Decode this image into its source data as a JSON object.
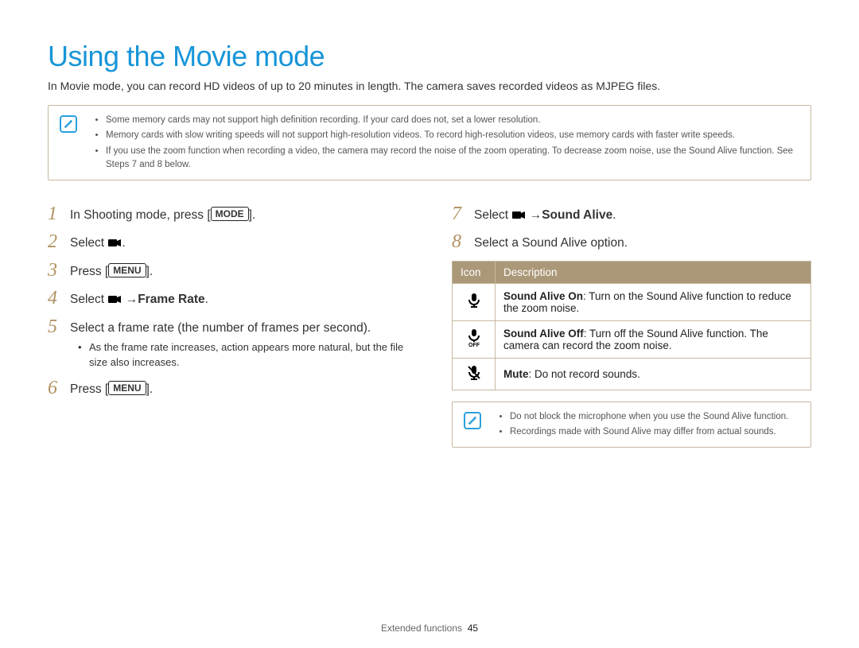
{
  "title": "Using the Movie mode",
  "intro": "In Movie mode, you can record HD videos of up to 20 minutes in length. The camera saves recorded videos as MJPEG files.",
  "note1": {
    "items": [
      "Some memory cards may not support high definition recording. If your card does not, set a lower resolution.",
      "Memory cards with slow writing speeds will not support high-resolution videos. To record high-resolution videos, use memory cards with faster write speeds.",
      "If you use the zoom function when recording a video, the camera may record the noise of the zoom operating. To decrease zoom noise, use the Sound Alive function. See Steps 7 and 8 below."
    ]
  },
  "badges": {
    "mode": "MODE",
    "menu": "MENU"
  },
  "steps_left": {
    "s1": {
      "num": "1",
      "pre": "In Shooting mode, press [",
      "post": "]."
    },
    "s2": {
      "num": "2",
      "pre": "Select ",
      "post": "."
    },
    "s3": {
      "num": "3",
      "pre": "Press [",
      "post": "]."
    },
    "s4": {
      "num": "4",
      "pre": "Select ",
      "link": "Frame Rate",
      "post": "."
    },
    "s5": {
      "num": "5",
      "text": "Select a frame rate (the number of frames per second).",
      "sub": "As the frame rate increases, action appears more natural, but the file size also increases."
    },
    "s6": {
      "num": "6",
      "pre": "Press [",
      "post": "]."
    }
  },
  "steps_right": {
    "s7": {
      "num": "7",
      "pre": "Select ",
      "link": "Sound Alive",
      "post": "."
    },
    "s8": {
      "num": "8",
      "text": "Select a Sound Alive option."
    }
  },
  "table": {
    "h1": "Icon",
    "h2": "Description",
    "rows": [
      {
        "title": "Sound Alive On",
        "desc": ": Turn on the Sound Alive function to reduce the zoom noise."
      },
      {
        "title": "Sound Alive Off",
        "desc": ": Turn off the Sound Alive function. The camera can record the zoom noise."
      },
      {
        "title": "Mute",
        "desc": ": Do not record sounds."
      }
    ]
  },
  "note2": {
    "items": [
      "Do not block the microphone when you use the Sound Alive function.",
      "Recordings made with Sound Alive may differ from actual sounds."
    ]
  },
  "footer": {
    "section": "Extended functions",
    "page": "45"
  }
}
